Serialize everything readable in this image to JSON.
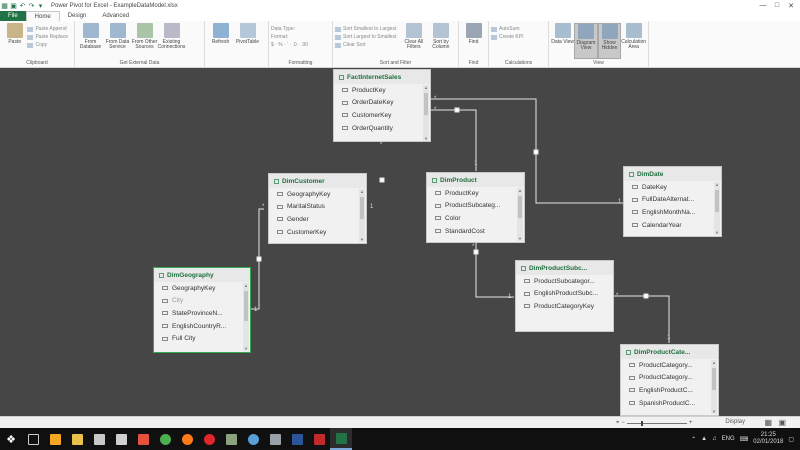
{
  "window": {
    "title": "Power Pivot for Excel - ExampleDataModel.xlsx",
    "controls": [
      "—",
      "□",
      "✕"
    ]
  },
  "tabs": [
    "File",
    "Home",
    "Design",
    "Advanced"
  ],
  "ribbon": {
    "clipboard": {
      "label": "Clipboard",
      "paste": "Paste",
      "paste_append": "Paste Append",
      "paste_replace": "Paste Replace",
      "copy": "Copy"
    },
    "external": {
      "label": "Get External Data",
      "from_database": "From Database",
      "from_data_service": "From Data Service",
      "from_other_sources": "From Other Sources",
      "existing_connections": "Existing Connections"
    },
    "refresh": {
      "refresh": "Refresh",
      "pivottable": "PivotTable"
    },
    "formatting": {
      "label": "Formatting",
      "data_type": "Data Type:",
      "format": "Format:",
      "symbols": "$ · % · ’ · .0 · .00"
    },
    "sort": {
      "label": "Sort and Filter",
      "sort_asc": "Sort Smallest to Largest",
      "sort_desc": "Sort Largest to Smallest",
      "clear_sort": "Clear Sort",
      "clear_filters": "Clear All Filters",
      "sort_by_column": "Sort by Column"
    },
    "find": {
      "label": "Find",
      "find": "Find"
    },
    "calc": {
      "label": "Calculations",
      "autosum": "AutoSum",
      "create_kpi": "Create KPI"
    },
    "view": {
      "label": "View",
      "data_view": "Data View",
      "diagram_view": "Diagram View",
      "show_hidden": "Show Hidden",
      "calc_area": "Calculation Area"
    }
  },
  "tables": [
    {
      "name": "FactInternetSales",
      "fields": [
        {
          "label": "ProductKey",
          "hidden": false
        },
        {
          "label": "OrderDateKey",
          "hidden": false
        },
        {
          "label": "CustomerKey",
          "hidden": false
        },
        {
          "label": "OrderQuantity",
          "hidden": false
        }
      ]
    },
    {
      "name": "DimCustomer",
      "fields": [
        {
          "label": "GeographyKey",
          "hidden": false
        },
        {
          "label": "MaritalStatus",
          "hidden": false
        },
        {
          "label": "Gender",
          "hidden": false
        },
        {
          "label": "CustomerKey",
          "hidden": false
        }
      ]
    },
    {
      "name": "DimProduct",
      "fields": [
        {
          "label": "ProductKey",
          "hidden": false
        },
        {
          "label": "ProductSubcateg...",
          "hidden": false
        },
        {
          "label": "Color",
          "hidden": false
        },
        {
          "label": "StandardCost",
          "hidden": false
        }
      ]
    },
    {
      "name": "DimDate",
      "fields": [
        {
          "label": "DateKey",
          "hidden": false
        },
        {
          "label": "FullDateAlternat...",
          "hidden": false
        },
        {
          "label": "EnglishMonthNa...",
          "hidden": false
        },
        {
          "label": "CalendarYear",
          "hidden": false
        }
      ]
    },
    {
      "name": "DimGeography",
      "fields": [
        {
          "label": "GeographyKey",
          "hidden": false
        },
        {
          "label": "City",
          "hidden": true
        },
        {
          "label": "StateProvinceN...",
          "hidden": false
        },
        {
          "label": "EnglishCountryR...",
          "hidden": false
        },
        {
          "label": "Full City",
          "hidden": false
        }
      ]
    },
    {
      "name": "DimProductSubc...",
      "fields": [
        {
          "label": "ProductSubcategor...",
          "hidden": false
        },
        {
          "label": "EnglishProductSubc...",
          "hidden": false
        },
        {
          "label": "ProductCategoryKey",
          "hidden": false
        }
      ]
    },
    {
      "name": "DimProductCate...",
      "fields": [
        {
          "label": "ProductCategory...",
          "hidden": false
        },
        {
          "label": "ProductCategory...",
          "hidden": false
        },
        {
          "label": "EnglishProductC...",
          "hidden": false
        },
        {
          "label": "SpanishProductC...",
          "hidden": false
        }
      ]
    }
  ],
  "relationship_labels": {
    "star": "*",
    "one": "1"
  },
  "status": {
    "display": "Display"
  },
  "taskbar": {
    "time": "21:25",
    "date": "02/01/2018",
    "lang": "ENG"
  },
  "colors": {
    "accent": "#217346",
    "canvas": "#464646",
    "table_header": "#1f6f3f",
    "selected_border": "#34a853"
  }
}
